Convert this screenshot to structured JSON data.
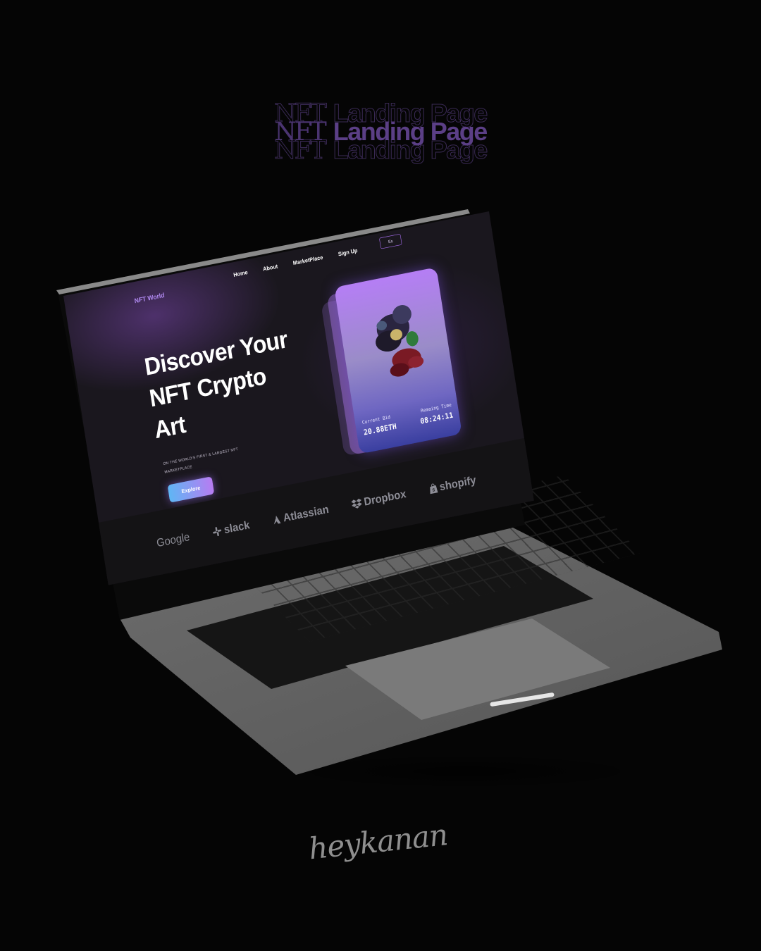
{
  "header": {
    "word1": "NFT",
    "word2": "Landing Page"
  },
  "site": {
    "brand": "NFT World",
    "nav": [
      "Home",
      "About",
      "MarketPlace",
      "Sign Up"
    ],
    "nav_button": "Es",
    "hero": {
      "line1": "Discover Your",
      "line2": "NFT Crypto",
      "line3": "Art",
      "subtitle": "ON THE WORLD'S FIRST & LARGEST NFT MARKETPLACE",
      "cta": "Explore"
    },
    "card": {
      "bid_label": "Current Bid",
      "bid_value": "20.88ETH",
      "time_label": "Remaing Time",
      "time_value": "08:24:11"
    },
    "partners": [
      "Google",
      "slack",
      "Atlassian",
      "Dropbox",
      "shopify"
    ]
  },
  "signature": "heykanan",
  "colors": {
    "accent_purple": "#b57ef5",
    "cta_gradient_start": "#5fb6f4",
    "cta_gradient_end": "#b77cf2",
    "background": "#050505"
  },
  "icons": {
    "slack": "slack-icon",
    "atlassian": "atlassian-icon",
    "dropbox": "dropbox-icon",
    "shopify": "shopify-bag-icon"
  }
}
